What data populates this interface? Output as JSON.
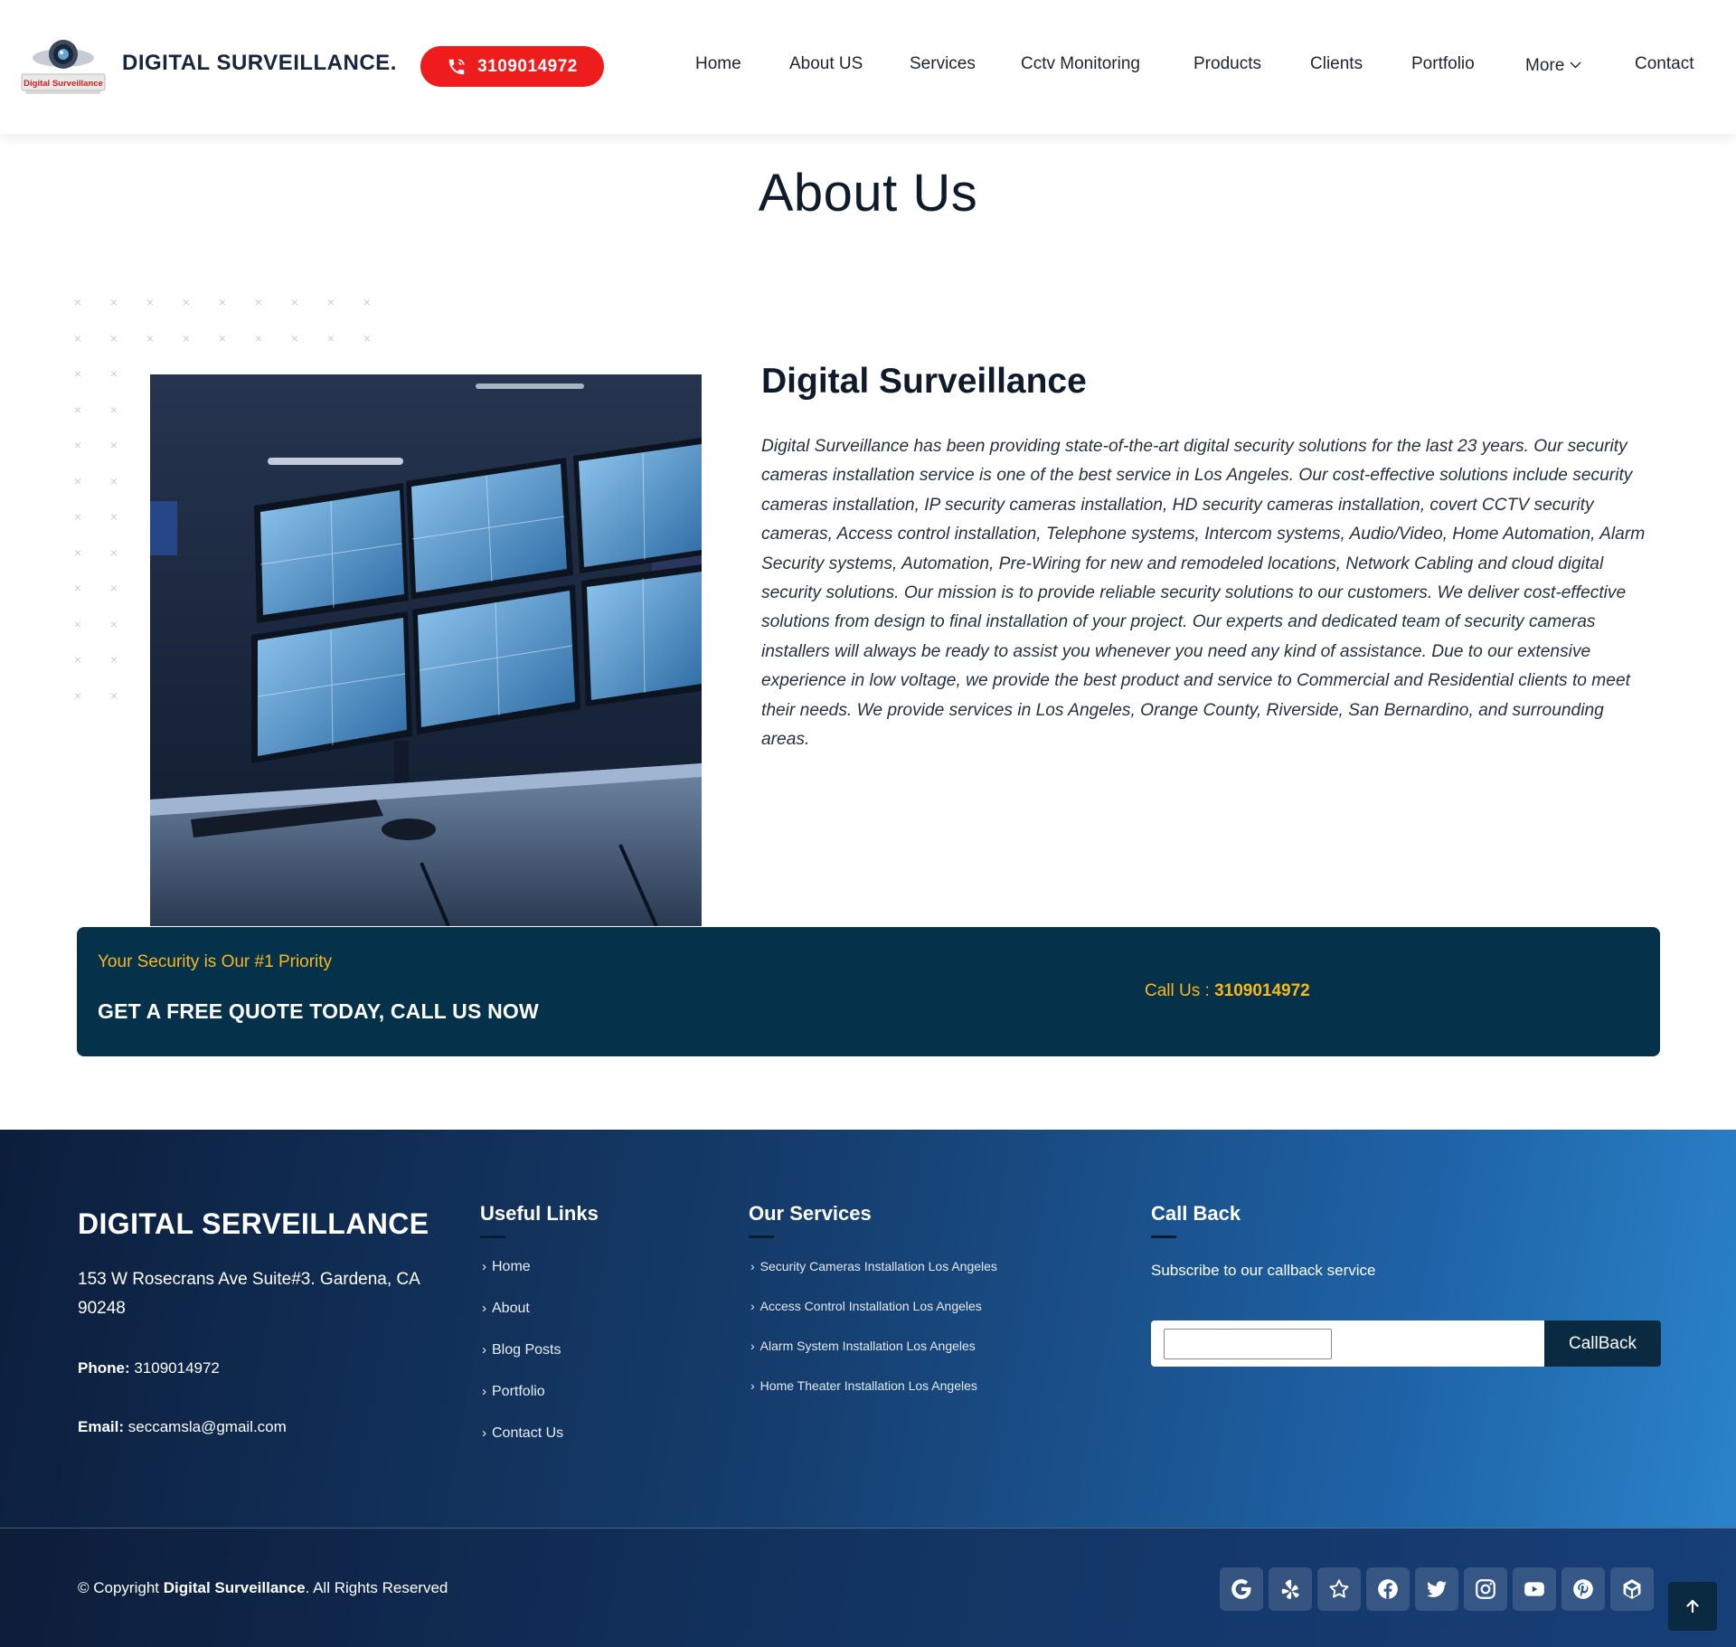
{
  "header": {
    "brand": "DIGITAL SURVEILLANCE.",
    "logo_text": "Digital Surveillance",
    "phone": "3109014972",
    "nav": [
      "Home",
      "About US",
      "Services",
      "Cctv Monitoring",
      "Products",
      "Clients",
      "Portfolio",
      "More",
      "Contact"
    ]
  },
  "about": {
    "title": "About Us",
    "heading": "Digital Surveillance",
    "body": "Digital Surveillance has been providing state-of-the-art digital security solutions for the last 23 years. Our security cameras installation service is one of the best service in Los Angeles. Our cost-effective solutions include security cameras installation, IP security cameras installation, HD security cameras installation, covert CCTV security cameras, Access control installation, Telephone systems, Intercom systems, Audio/Video, Home Automation, Alarm Security systems, Automation, Pre-Wiring for new and remodeled locations, Network Cabling and cloud digital security solutions. Our mission is to provide reliable security solutions to our customers. We deliver cost-effective solutions from design to final installation of your project. Our experts and dedicated team of security cameras installers will always be ready to assist you whenever you need any kind of assistance. Due to our extensive experience in low voltage, we provide the best product and service to Commercial and Residential clients to meet their needs. We provide services in Los Angeles, Orange County, Riverside, San Bernardino, and surrounding areas."
  },
  "cta": {
    "kicker": "Your Security is Our #1 Priority",
    "main": "GET A FREE QUOTE TODAY, CALL US NOW",
    "call_label": "Call Us : ",
    "call_number": "3109014972"
  },
  "footer": {
    "brand": "DIGITAL SERVEILLANCE",
    "address": "153 W Rosecrans Ave Suite#3. Gardena, CA 90248",
    "phone_label": "Phone:",
    "phone": "3109014972",
    "email_label": "Email:",
    "email": "seccamsla@gmail.com",
    "useful_links_title": "Useful Links",
    "useful_links": [
      "Home",
      "About",
      "Blog Posts",
      "Portfolio",
      "Contact Us"
    ],
    "services_title": "Our Services",
    "services": [
      "Security Cameras Installation Los Angeles",
      "Access Control Installation Los Angeles",
      "Alarm System Installation Los Angeles",
      "Home Theater Installation Los Angeles"
    ],
    "callback_title": "Call Back",
    "callback_sub": "Subscribe to our callback service",
    "callback_placeholder": "",
    "callback_button": "CallBack",
    "copyright_prefix": "© Copyright ",
    "copyright_brand": "Digital Surveillance",
    "copyright_suffix": ". All Rights Reserved",
    "social_icons": [
      "google-icon",
      "yelp-icon",
      "star-icon",
      "facebook-icon",
      "twitter-icon",
      "instagram-icon",
      "youtube-icon",
      "pinterest-icon",
      "unity-icon"
    ]
  },
  "colors": {
    "accent_red": "#ee1c1c",
    "cta_bg": "#06314b",
    "cta_yellow": "#f7b81c",
    "footer_dark": "#0c1e3c",
    "footer_light": "#2b85cc"
  }
}
